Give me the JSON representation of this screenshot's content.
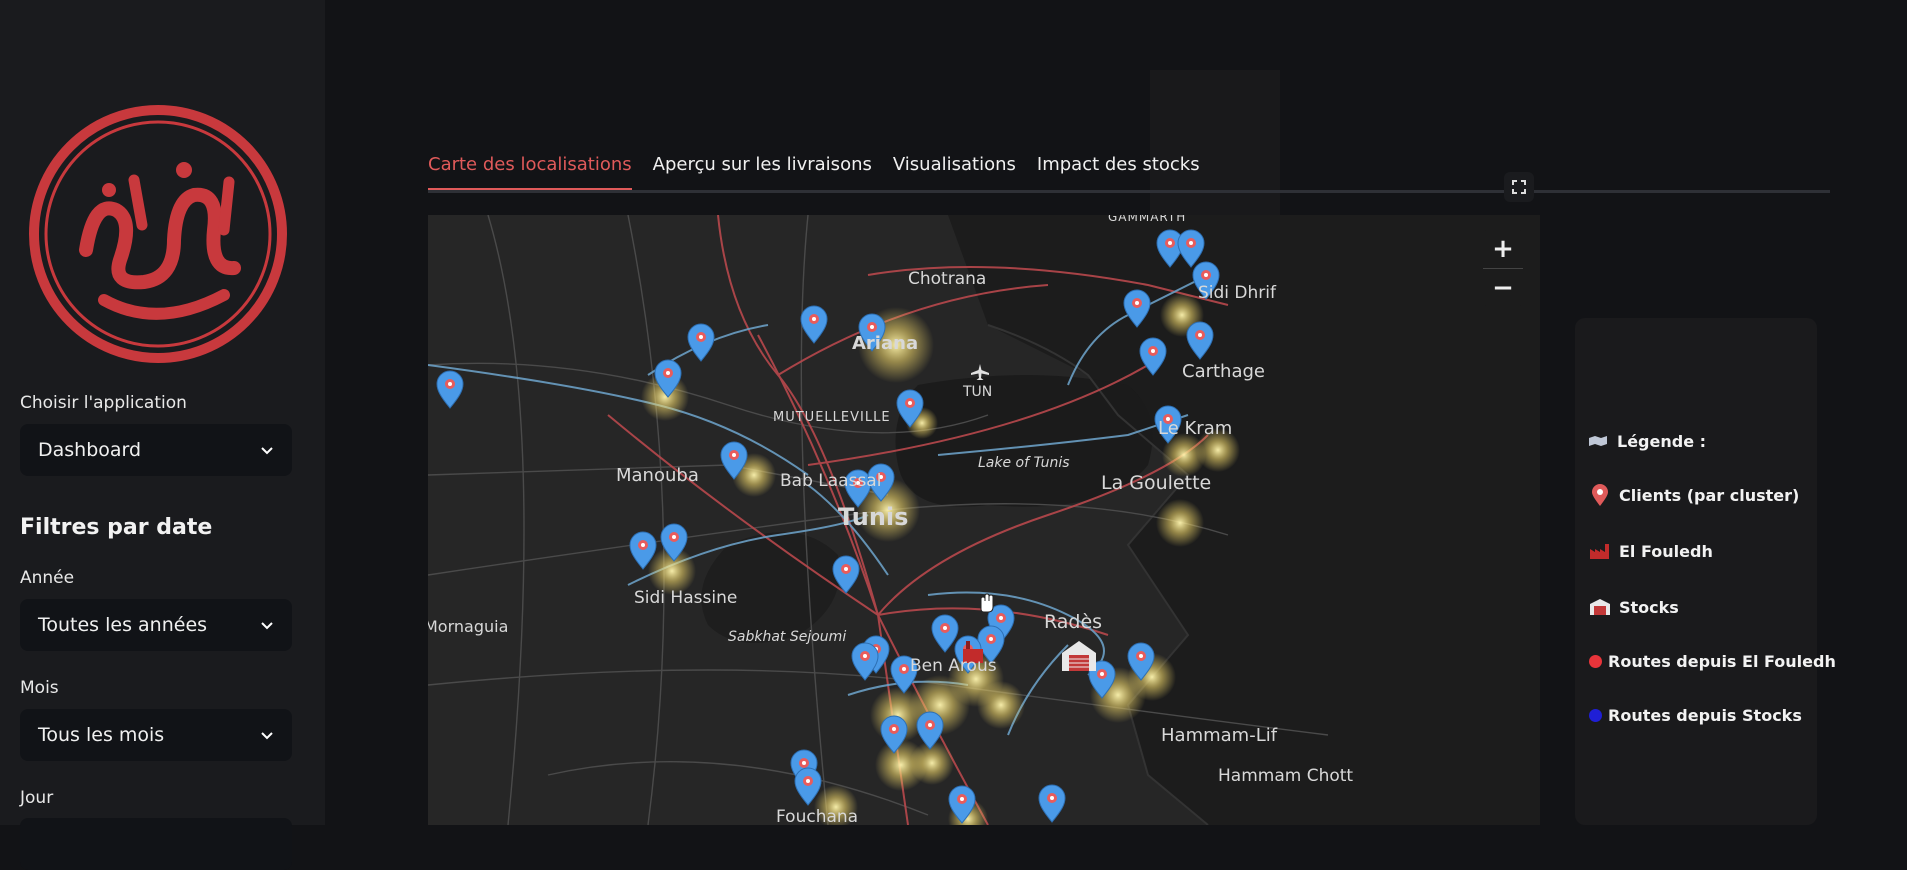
{
  "sidebar": {
    "app_label": "Choisir l'application",
    "app_value": "Dashboard",
    "filters_heading": "Filtres par date",
    "year_label": "Année",
    "year_value": "Toutes les années",
    "month_label": "Mois",
    "month_value": "Tous les mois",
    "day_label": "Jour"
  },
  "tabs": [
    {
      "label": "Carte des localisations",
      "active": true
    },
    {
      "label": "Aperçu sur les livraisons",
      "active": false
    },
    {
      "label": "Visualisations",
      "active": false
    },
    {
      "label": "Impact des stocks",
      "active": false
    }
  ],
  "map": {
    "labels": {
      "gammarth": "GAMMARTH",
      "chotrana": "Chotrana",
      "sidi_dhrif": "Sidi Dhrif",
      "ariana": "Ariana",
      "carthage": "Carthage",
      "tun": "TUN",
      "mutuelleville": "MUTUELLEVILLE",
      "kram": "Le Kram",
      "manouba": "Manouba",
      "bab_laassal": "Bab Laassal",
      "lake": "Lake of Tunis",
      "la_goulette": "La Goulette",
      "tunis": "Tunis",
      "sidi_hassine": "Sidi Hassine",
      "rades": "Radès",
      "mornaguia": "Mornaguia",
      "sabkhat": "Sabkhat Sejoumi",
      "ben_arous": "Ben Arous",
      "hammam_lif": "Hammam-Lif",
      "hammam_chott": "Hammam Chott",
      "fouchana": "Fouchana"
    },
    "zoom_in": "+",
    "zoom_out": "−"
  },
  "legend": {
    "title": "Légende :",
    "items": [
      {
        "label": "Clients (par cluster)",
        "icon": "client-marker-icon"
      },
      {
        "label": "El Fouledh",
        "icon": "factory-icon"
      },
      {
        "label": "Stocks",
        "icon": "warehouse-icon"
      },
      {
        "label": "Routes depuis El Fouledh",
        "color": "#e8343a"
      },
      {
        "label": "Routes depuis Stocks",
        "color": "#1f1fd6"
      }
    ]
  },
  "colors": {
    "accent": "#e05a5a",
    "marker": "#4a9ae8",
    "route_fouledh": "#b8484c",
    "route_stocks": "#6a9ec4"
  }
}
